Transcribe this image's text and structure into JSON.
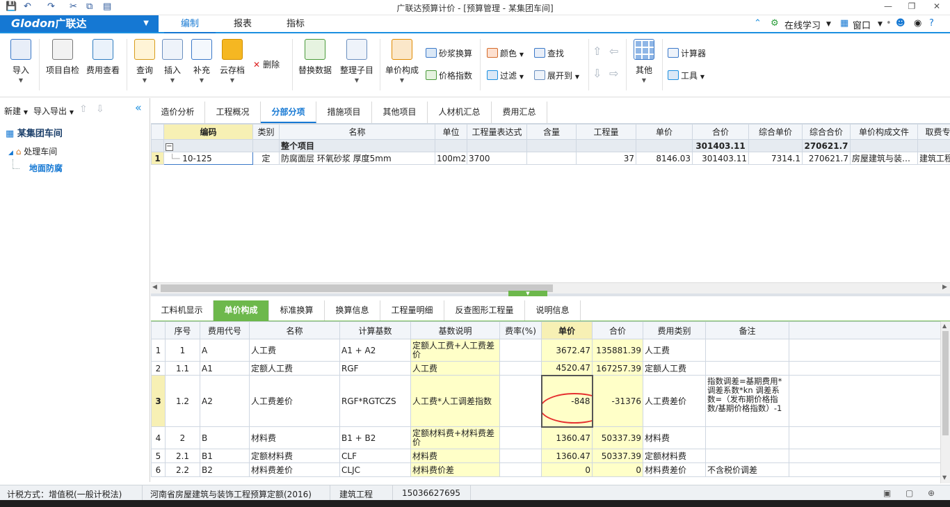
{
  "window": {
    "title": "广联达预算计价 - [预算管理 - 某集团车间]"
  },
  "menubar": {
    "brand": "Glodon",
    "brand_cn": "广联达",
    "tabs": [
      "编制",
      "报表",
      "指标"
    ],
    "online_learning": "在线学习",
    "window_menu": "窗口"
  },
  "ribbon": {
    "import": "导入",
    "self_check": "项目自检",
    "cost_view": "费用查看",
    "query": "查询",
    "insert": "插入",
    "supplement": "补充",
    "cloud_save": "云存档",
    "delete": "删除",
    "replace_data": "替换数据",
    "organize": "整理子目",
    "unit_price_comp": "单价构成",
    "mortar_convert": "砂浆换算",
    "price_index": "价格指数",
    "color": "颜色",
    "find": "查找",
    "filter": "过滤",
    "expand_to": "展开到",
    "other": "其他",
    "calculator": "计算器",
    "tools": "工具"
  },
  "left_panel": {
    "new": "新建",
    "import_export": "导入导出",
    "project": "某集团车间",
    "child": "处理车间",
    "grandchild": "地面防腐"
  },
  "main_tabs": [
    "造价分析",
    "工程概况",
    "分部分项",
    "措施项目",
    "其他项目",
    "人材机汇总",
    "费用汇总"
  ],
  "upper_grid": {
    "headers": [
      "编码",
      "类别",
      "名称",
      "单位",
      "工程量表达式",
      "含量",
      "工程量",
      "单价",
      "合价",
      "综合单价",
      "综合合价",
      "单价构成文件",
      "取费专"
    ],
    "total_row": {
      "name": "整个项目",
      "total": "301403.11",
      "comp_total": "270621.7"
    },
    "row1": {
      "idx": "1",
      "code": "10-125",
      "type": "定",
      "name": "防腐面层 环氧砂浆 厚度5mm",
      "unit": "100m2",
      "expr": "3700",
      "content": "",
      "qty": "37",
      "price": "8146.03",
      "total": "301403.11",
      "comp_price": "7314.1",
      "comp_total": "270621.7",
      "file": "房屋建筑与装…",
      "fee": "建筑工程"
    }
  },
  "lower_tabs": [
    "工料机显示",
    "单价构成",
    "标准换算",
    "换算信息",
    "工程量明细",
    "反查图形工程量",
    "说明信息"
  ],
  "lower_grid": {
    "headers": [
      "序号",
      "费用代号",
      "名称",
      "计算基数",
      "基数说明",
      "费率(%)",
      "单价",
      "合价",
      "费用类别",
      "备注"
    ],
    "rows": [
      {
        "n": "1",
        "seq": "1",
        "code": "A",
        "name": "人工费",
        "base": "A1 + A2",
        "desc": "定额人工费+人工费差价",
        "rate": "",
        "price": "3672.47",
        "total": "135881.39",
        "cat": "人工费",
        "note": ""
      },
      {
        "n": "2",
        "seq": "1.1",
        "code": "A1",
        "name": "定额人工费",
        "base": "RGF",
        "desc": "人工费",
        "rate": "",
        "price": "4520.47",
        "total": "167257.39",
        "cat": "定额人工费",
        "note": ""
      },
      {
        "n": "3",
        "seq": "1.2",
        "code": "A2",
        "name": "人工费差价",
        "base": "RGF*RGTCZS",
        "desc": "人工费*人工调差指数",
        "rate": "",
        "price": "-848",
        "total": "-31376",
        "cat": "人工费差价",
        "note": "指数调差=基期费用*调差系数*kn 调差系数=（发布期价格指数/基期价格指数）-1"
      },
      {
        "n": "4",
        "seq": "2",
        "code": "B",
        "name": "材料费",
        "base": "B1 + B2",
        "desc": "定额材料费+材料费差价",
        "rate": "",
        "price": "1360.47",
        "total": "50337.39",
        "cat": "材料费",
        "note": ""
      },
      {
        "n": "5",
        "seq": "2.1",
        "code": "B1",
        "name": "定额材料费",
        "base": "CLF",
        "desc": "材料费",
        "rate": "",
        "price": "1360.47",
        "total": "50337.39",
        "cat": "定额材料费",
        "note": ""
      },
      {
        "n": "6",
        "seq": "2.2",
        "code": "B2",
        "name": "材料费差价",
        "base": "CLJC",
        "desc": "材料费价差",
        "rate": "",
        "price": "0",
        "total": "0",
        "cat": "材料费差价",
        "note": "不含税价调差"
      }
    ]
  },
  "status": {
    "tax": "计税方式：增值税(一般计税法)",
    "quota": "河南省房屋建筑与装饰工程预算定额(2016)",
    "discipline": "建筑工程",
    "phone": "15036627695"
  }
}
